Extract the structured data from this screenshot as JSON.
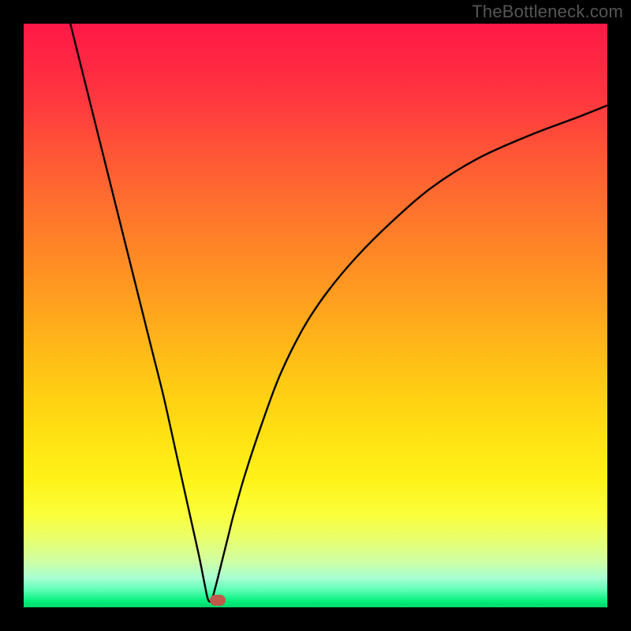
{
  "watermark": "TheBottleneck.com",
  "colors": {
    "frame": "#000000",
    "curve_stroke": "#000000",
    "marker_fill": "#c05a4a",
    "gradient_stops": [
      {
        "pct": 0,
        "c": "#ff1846"
      },
      {
        "pct": 6,
        "c": "#ff2643"
      },
      {
        "pct": 14,
        "c": "#ff3a3e"
      },
      {
        "pct": 22,
        "c": "#ff5536"
      },
      {
        "pct": 30,
        "c": "#ff6d2f"
      },
      {
        "pct": 38,
        "c": "#ff8427"
      },
      {
        "pct": 46,
        "c": "#ff9b20"
      },
      {
        "pct": 54,
        "c": "#ffb419"
      },
      {
        "pct": 62,
        "c": "#ffcb14"
      },
      {
        "pct": 70,
        "c": "#ffe012"
      },
      {
        "pct": 78,
        "c": "#fff219"
      },
      {
        "pct": 84,
        "c": "#fbff3a"
      },
      {
        "pct": 88,
        "c": "#eaff6a"
      },
      {
        "pct": 92,
        "c": "#d1ffa2"
      },
      {
        "pct": 95,
        "c": "#a7ffd3"
      },
      {
        "pct": 97,
        "c": "#5effb7"
      },
      {
        "pct": 99,
        "c": "#00f07a"
      },
      {
        "pct": 100,
        "c": "#00d66a"
      }
    ]
  },
  "chart_data": {
    "type": "line",
    "title": "",
    "xlabel": "",
    "ylabel": "",
    "xlim": [
      0,
      100
    ],
    "ylim": [
      0,
      100
    ],
    "series": [
      {
        "name": "curve",
        "x": [
          8,
          10,
          12,
          14,
          16,
          18,
          20,
          22,
          24,
          26,
          28,
          30,
          31,
          31.6,
          32.2,
          33,
          34,
          35,
          36,
          38,
          41,
          44,
          48,
          52,
          57,
          63,
          70,
          78,
          87,
          95,
          100
        ],
        "y": [
          100,
          92,
          84,
          76,
          68,
          60,
          52,
          44,
          36,
          27,
          18,
          9,
          4,
          1.3,
          1.3,
          4,
          8,
          12,
          16,
          23,
          32,
          40,
          48,
          54,
          60,
          66,
          72,
          77,
          81,
          84,
          86
        ]
      }
    ],
    "marker": {
      "x": 33.2,
      "y": 1.2
    }
  }
}
